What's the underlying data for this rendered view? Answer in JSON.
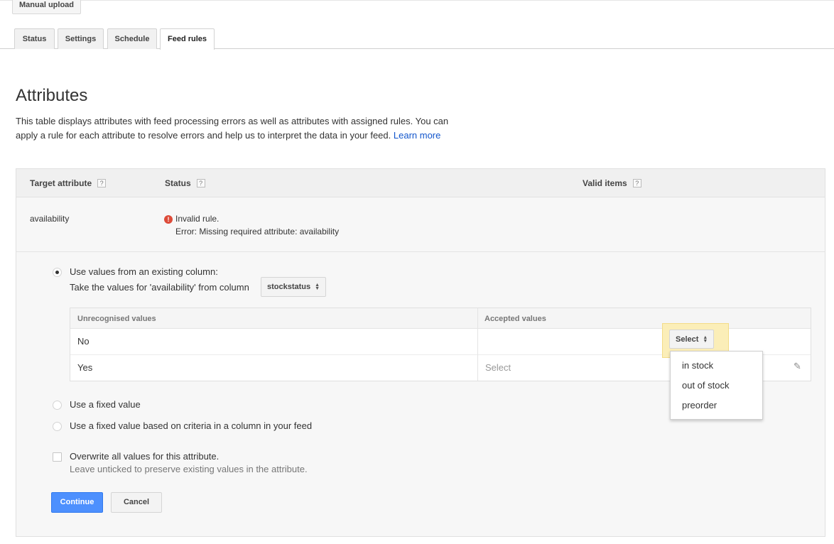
{
  "top_button": "Manual upload",
  "tabs": [
    {
      "label": "Status"
    },
    {
      "label": "Settings"
    },
    {
      "label": "Schedule"
    },
    {
      "label": "Feed rules"
    }
  ],
  "page": {
    "title": "Attributes",
    "description": "This table displays attributes with feed processing errors as well as attributes with assigned rules. You can apply a rule for each attribute to resolve errors and help us to interpret the data in your feed.",
    "learn_more": "Learn more"
  },
  "table": {
    "headers": {
      "target_attribute": "Target attribute",
      "status": "Status",
      "valid_items": "Valid items",
      "help_glyph": "?"
    },
    "row": {
      "attribute": "availability",
      "status_title": "Invalid rule.",
      "status_error": "Error: Missing required attribute: availability"
    }
  },
  "rule": {
    "option_existing_column": "Use values from an existing column:",
    "take_values_text": "Take the values for 'availability' from column",
    "column_select_value": "stockstatus",
    "mapping": {
      "col_unrecognised": "Unrecognised values",
      "col_accepted": "Accepted values",
      "rows": [
        {
          "value": "No",
          "accepted": "Select"
        },
        {
          "value": "Yes",
          "accepted": "Select"
        }
      ]
    },
    "dropdown_options": [
      "in stock",
      "out of stock",
      "preorder"
    ],
    "option_fixed_value": "Use a fixed value",
    "option_fixed_criteria": "Use a fixed value based on criteria in a column in your feed",
    "overwrite_label": "Overwrite all values for this attribute.",
    "overwrite_hint": "Leave unticked to preserve existing values in the attribute."
  },
  "buttons": {
    "continue": "Continue",
    "cancel": "Cancel"
  },
  "colors": {
    "primary": "#4d90fe",
    "link": "#15c",
    "error": "#dd4b39",
    "highlight": "#fbeeb8"
  }
}
